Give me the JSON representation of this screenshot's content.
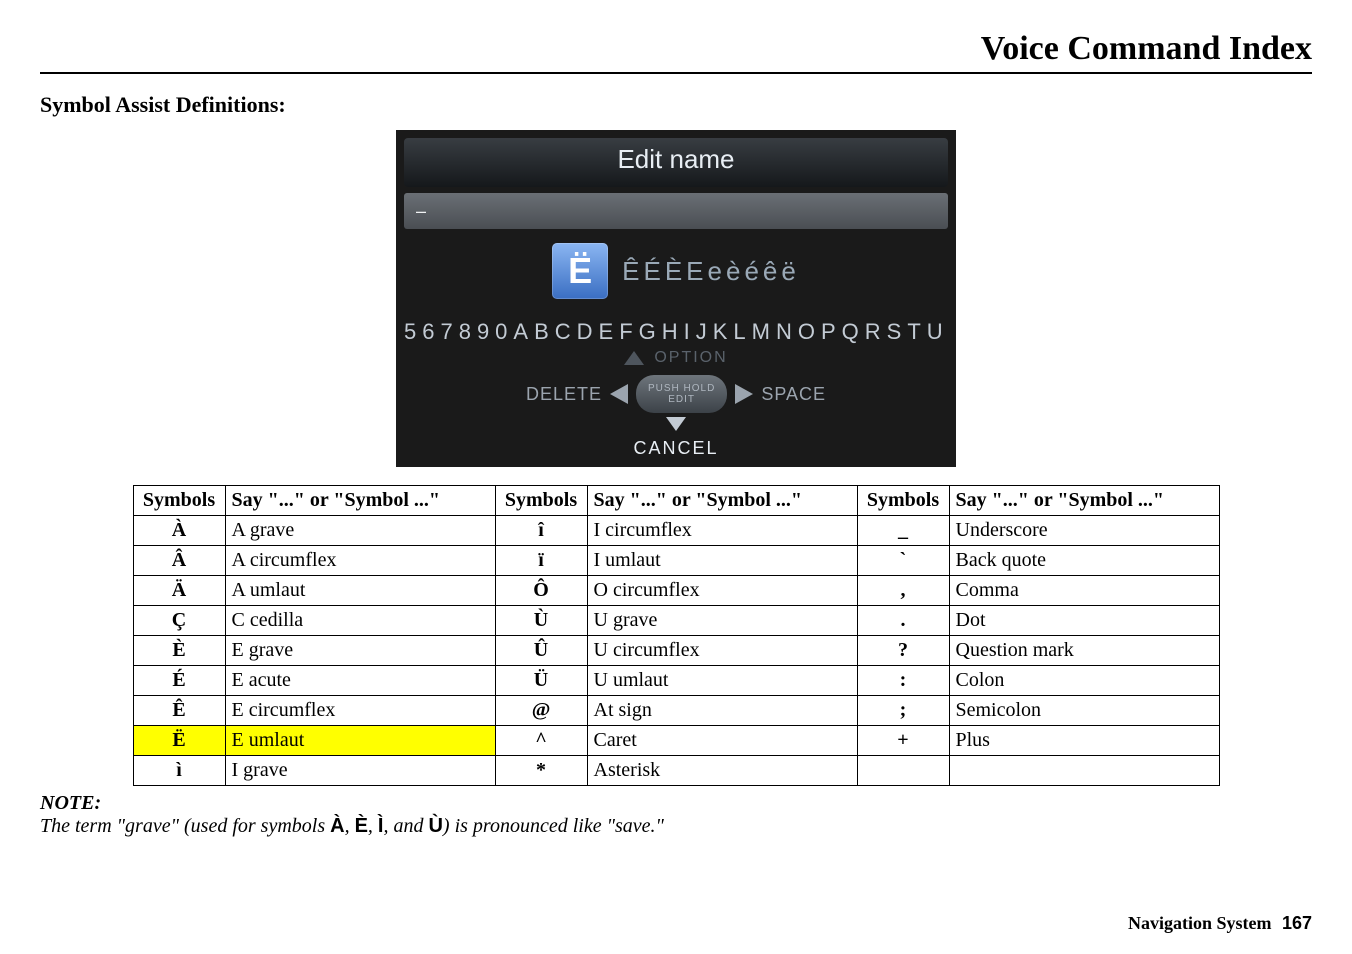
{
  "header": {
    "title": "Voice Command Index"
  },
  "section": {
    "title": "Symbol Assist Definitions:"
  },
  "screenshot": {
    "title": "Edit name",
    "input_value": "–",
    "big_key": "Ë",
    "variants": "ÊÉÈEeèéêë",
    "keyboard_row": "567890ABCDEFGHIJKLMNOPQRSTU",
    "option_label": "OPTION",
    "left_label": "DELETE",
    "center_top": "PUSH HOLD",
    "center_bottom": "EDIT",
    "right_label": "SPACE",
    "cancel_label": "CANCEL"
  },
  "table": {
    "headers": {
      "symbols": "Symbols",
      "say": "Say \"...\" or \"Symbol ...\""
    },
    "col1": [
      {
        "sym": "À",
        "say": "A grave"
      },
      {
        "sym": "Â",
        "say": "A circumflex"
      },
      {
        "sym": "Ä",
        "say": "A umlaut"
      },
      {
        "sym": "Ç",
        "say": "C cedilla"
      },
      {
        "sym": "È",
        "say": "E grave"
      },
      {
        "sym": "É",
        "say": "E acute"
      },
      {
        "sym": "Ê",
        "say": "E circumflex"
      },
      {
        "sym": "Ë",
        "say": "E umlaut",
        "hl": true
      },
      {
        "sym": "ì",
        "say": "I grave"
      }
    ],
    "col2": [
      {
        "sym": "î",
        "say": "I circumflex"
      },
      {
        "sym": "ï",
        "say": "I umlaut"
      },
      {
        "sym": "Ô",
        "say": "O circumflex"
      },
      {
        "sym": "Ù",
        "say": "U grave"
      },
      {
        "sym": "Û",
        "say": "U circumflex"
      },
      {
        "sym": "Ü",
        "say": "U umlaut"
      },
      {
        "sym": "@",
        "say": "At sign"
      },
      {
        "sym": "^",
        "say": "Caret"
      },
      {
        "sym": "*",
        "say": "Asterisk"
      }
    ],
    "col3": [
      {
        "sym": "_",
        "say": "Underscore"
      },
      {
        "sym": "`",
        "say": "Back quote"
      },
      {
        "sym": ",",
        "say": "Comma"
      },
      {
        "sym": ".",
        "say": "Dot"
      },
      {
        "sym": "?",
        "say": "Question mark"
      },
      {
        "sym": ":",
        "say": "Colon"
      },
      {
        "sym": ";",
        "say": "Semicolon"
      },
      {
        "sym": "+",
        "say": "Plus"
      },
      {
        "sym": "",
        "say": ""
      }
    ]
  },
  "note": {
    "label": "NOTE:",
    "pre": "The term \"grave\" (used for symbols ",
    "s1": "À",
    "c1": ", ",
    "s2": "È",
    "c2": ", ",
    "s3": "Ì",
    "c3": ", and ",
    "s4": "Ù",
    "post": ") is pronounced like \"save.\""
  },
  "footer": {
    "label": "Navigation System",
    "page": "167"
  }
}
